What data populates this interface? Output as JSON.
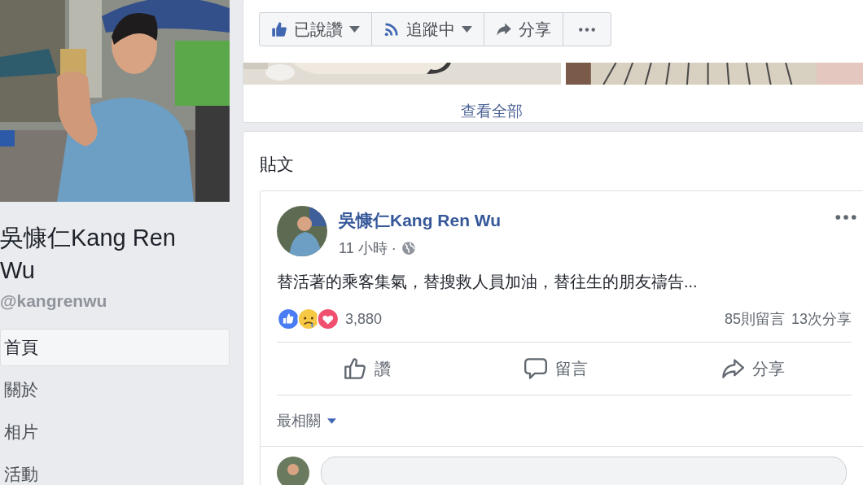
{
  "sidebar": {
    "name": "吳慷仁Kang Ren Wu",
    "handle": "@kangrenwu",
    "nav": [
      {
        "label": "首頁",
        "selected": true
      },
      {
        "label": "關於",
        "selected": false
      },
      {
        "label": "相片",
        "selected": false
      },
      {
        "label": "活動",
        "selected": false
      }
    ]
  },
  "page_actions": [
    {
      "kind": "like",
      "label": "已說讚",
      "dropdown": true
    },
    {
      "kind": "follow",
      "label": "追蹤中",
      "dropdown": true
    },
    {
      "kind": "share",
      "label": "分享",
      "dropdown": false
    },
    {
      "kind": "more",
      "dropdown": false
    }
  ],
  "photos": {
    "see_all": "查看全部"
  },
  "posts": {
    "heading": "貼文",
    "post": {
      "author": "吳慷仁Kang Ren Wu",
      "time": "11 小時 ·",
      "text": "替活著的乘客集氣，替搜救人員加油，替往生的朋友禱告...",
      "reactions": "3,880",
      "comments": "85則留言",
      "shares": "13次分享",
      "actions": [
        {
          "kind": "like",
          "label": "讚"
        },
        {
          "kind": "comment",
          "label": "留言"
        },
        {
          "kind": "share",
          "label": "分享"
        }
      ],
      "sort": "最相關"
    }
  }
}
